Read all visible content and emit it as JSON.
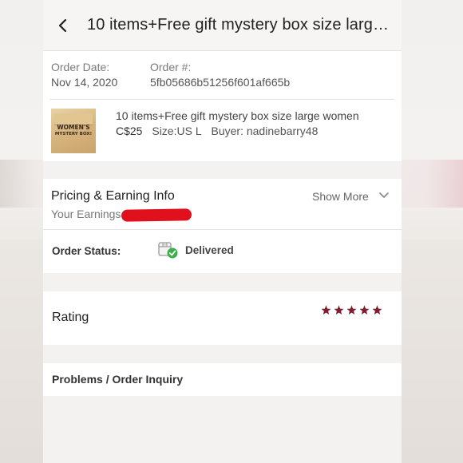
{
  "header": {
    "title": "10 items+Free gift mystery box size larg…",
    "back_icon": "chevron-left-icon"
  },
  "order": {
    "date_label": "Order Date:",
    "date_value": "Nov 14, 2020",
    "number_label": "Order #:",
    "number_value": "5fb05686b51256f601af665b"
  },
  "item": {
    "thumbnail_text": "WOMEN'S",
    "thumbnail_subtext": "MYSTERY BOX!",
    "title": "10 items+Free gift mystery box size large women",
    "price": "C$25",
    "size": "Size:US L",
    "buyer": "Buyer: nadinebarry48"
  },
  "pricing": {
    "title": "Pricing & Earning Info",
    "earnings_label": "Your Earnings",
    "show_more": "Show More",
    "redaction_color": "#e0111d"
  },
  "status": {
    "label": "Order Status:",
    "value": "Delivered",
    "icon": "delivered-box-check-icon",
    "check_color": "#3bb04a"
  },
  "rating": {
    "label": "Rating",
    "stars": 5,
    "star_color": "#7d1f2e"
  },
  "problems": {
    "label": "Problems / Order Inquiry"
  }
}
